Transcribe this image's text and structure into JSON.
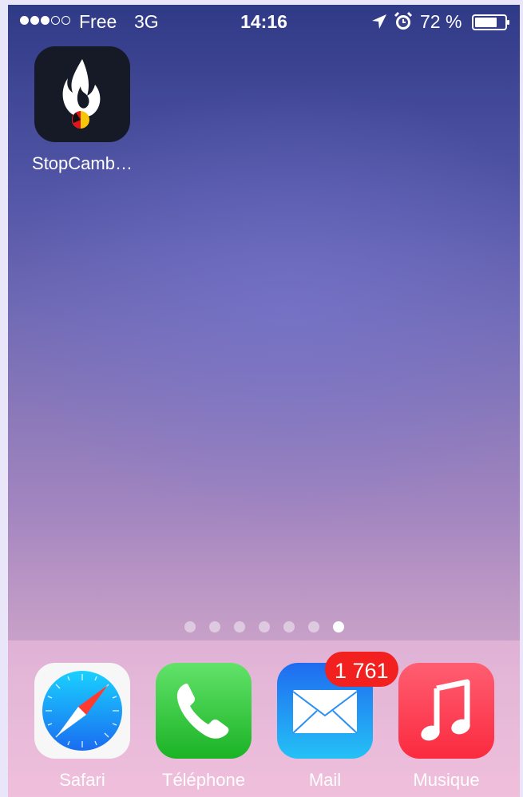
{
  "status_bar": {
    "signal_dots_full": 3,
    "signal_dots_empty": 2,
    "carrier": "Free",
    "network": "3G",
    "time": "14:16",
    "battery_percent": "72 %",
    "battery_level": 0.72,
    "icons": [
      "location-arrow-icon",
      "alarm-clock-icon",
      "battery-icon"
    ]
  },
  "home": {
    "apps": [
      {
        "label": "StopCamb…",
        "icon": "stopcamb-flame-icon"
      }
    ]
  },
  "page_indicator": {
    "count": 7,
    "active_index": 6
  },
  "dock": {
    "apps": [
      {
        "label": "Safari",
        "icon": "safari-compass-icon"
      },
      {
        "label": "Téléphone",
        "icon": "phone-handset-icon"
      },
      {
        "label": "Mail",
        "icon": "mail-envelope-icon",
        "badge": "1 761"
      },
      {
        "label": "Musique",
        "icon": "music-note-icon"
      }
    ]
  },
  "colors": {
    "badge": "#f2201e",
    "phone_green": "#1bb325",
    "mail_blue": "#1f6bf0",
    "music_red": "#fb2a3f"
  }
}
